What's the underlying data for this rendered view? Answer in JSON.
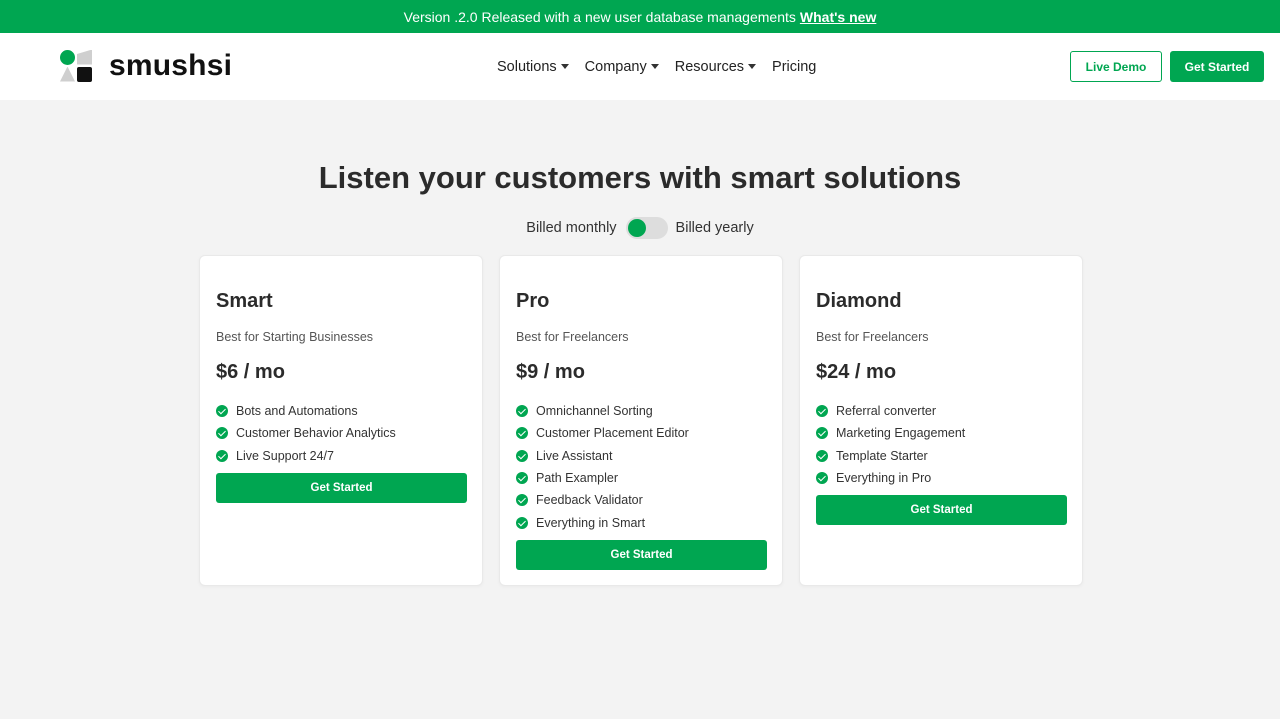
{
  "announcement": {
    "text": "Version .2.0 Released with a new user database managements",
    "link": "What's new"
  },
  "header": {
    "brand": "smushsi",
    "nav": [
      {
        "label": "Solutions",
        "has_dropdown": true
      },
      {
        "label": "Company",
        "has_dropdown": true
      },
      {
        "label": "Resources",
        "has_dropdown": true
      },
      {
        "label": "Pricing",
        "has_dropdown": false
      }
    ],
    "live_demo_label": "Live Demo",
    "get_started_label": "Get Started"
  },
  "hero": {
    "title": "Listen your customers with smart solutions",
    "billed_monthly": "Billed monthly",
    "billed_yearly": "Billed yearly"
  },
  "plans": [
    {
      "name": "Smart",
      "subtitle": "Best for Starting Businesses",
      "price": "$6 / mo",
      "features": [
        "Bots and Automations",
        "Customer Behavior Analytics",
        "Live Support 24/7"
      ],
      "cta": "Get Started"
    },
    {
      "name": "Pro",
      "subtitle": "Best for Freelancers",
      "price": "$9 / mo",
      "features": [
        "Omnichannel Sorting",
        "Customer Placement Editor",
        "Live Assistant",
        "Path Exampler",
        "Feedback Validator",
        "Everything in Smart"
      ],
      "cta": "Get Started"
    },
    {
      "name": "Diamond",
      "subtitle": "Best for Freelancers",
      "price": "$24 / mo",
      "features": [
        "Referral converter",
        "Marketing Engagement",
        "Template Starter",
        "Everything in Pro"
      ],
      "cta": "Get Started"
    }
  ],
  "colors": {
    "accent": "#00a651",
    "page_background": "#f3f3f3",
    "card_background": "#ffffff",
    "text": "#2b2b2b"
  },
  "icons": {
    "feature": "check-circle-icon",
    "dropdown": "caret-down-icon"
  }
}
